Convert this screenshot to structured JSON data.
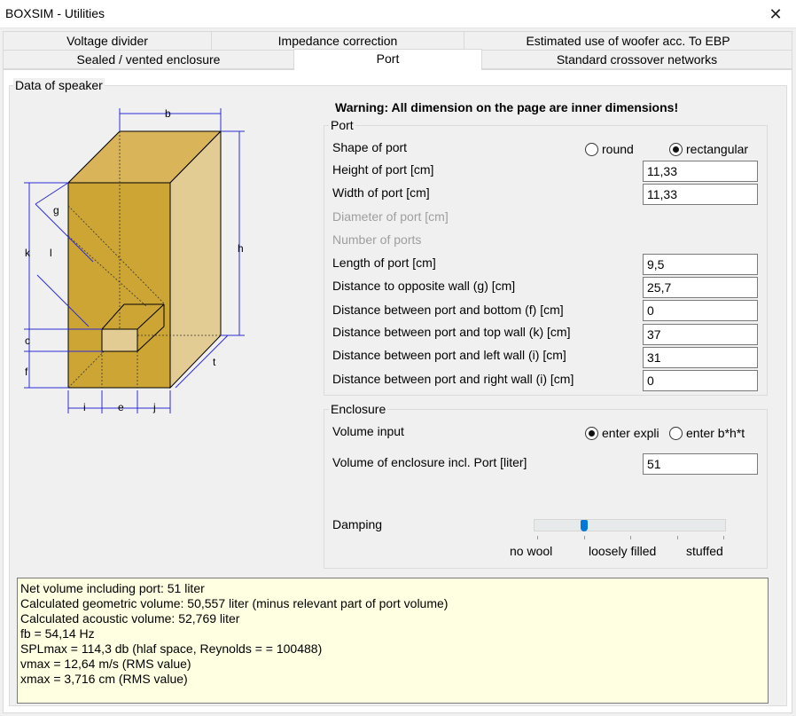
{
  "window": {
    "title": "BOXSIM - Utilities"
  },
  "tabs": {
    "row1": [
      "Voltage divider",
      "Impedance correction",
      "Estimated use of woofer acc. To EBP"
    ],
    "row2": [
      "Sealed / vented enclosure",
      "Port",
      "Standard crossover networks"
    ],
    "active": "Port"
  },
  "speaker_group": {
    "title": "Data of speaker"
  },
  "diagram": {
    "labels": [
      "b",
      "g",
      "k",
      "l",
      "h",
      "c",
      "f",
      "t",
      "i",
      "e",
      "j"
    ]
  },
  "warning": "Warning: All dimension on the page are inner dimensions!",
  "port": {
    "title": "Port",
    "shape_label": "Shape of port",
    "shape_options": [
      "round",
      "rectangular"
    ],
    "shape_selected": "rectangular",
    "height_label": "Height of port [cm]",
    "height_value": "11,33",
    "width_label": "Width of port [cm]",
    "width_value": "11,33",
    "diameter_label": "Diameter of port [cm]",
    "number_label": "Number of ports",
    "length_label": "Length of port [cm]",
    "length_value": "9,5",
    "opposite_label": "Distance to opposite wall (g) [cm]",
    "opposite_value": "25,7",
    "bottom_label": "Distance between port and bottom (f) [cm]",
    "bottom_value": "0",
    "top_label": "Distance between port and top wall (k) [cm]",
    "top_value": "37",
    "left_label": "Distance between port and left wall (i) [cm]",
    "left_value": "31",
    "right_label": "Distance between port and right wall (i) [cm]",
    "right_value": "0"
  },
  "enclosure": {
    "title": "Enclosure",
    "volume_input_label": "Volume input",
    "volume_options": [
      "enter expli",
      "enter b*h*t"
    ],
    "volume_selected": "enter expli",
    "volume_label": "Volume of enclosure incl. Port [liter]",
    "volume_value": "51",
    "damping_label": "Damping",
    "damping_marks": [
      "no wool",
      "loosely filled",
      "stuffed"
    ],
    "damping_level": 0.25
  },
  "results": [
    "Net volume including port: 51 liter",
    "Calculated geometric volume: 50,557 liter (minus relevant part of port volume)",
    "Calculated acoustic volume: 52,769 liter",
    "fb = 54,14 Hz",
    "SPLmax = 114,3 db (hlaf space, Reynolds =  = 100488)",
    "vmax = 12,64 m/s (RMS value)",
    "xmax = 3,716 cm (RMS value)"
  ],
  "colors": {
    "box_front": "#cda535",
    "box_top": "#d9b458",
    "box_side": "#e3cc93",
    "dim_lines": "#2b2bd6",
    "results_bg": "#ffffe1",
    "accent": "#0078d7"
  }
}
